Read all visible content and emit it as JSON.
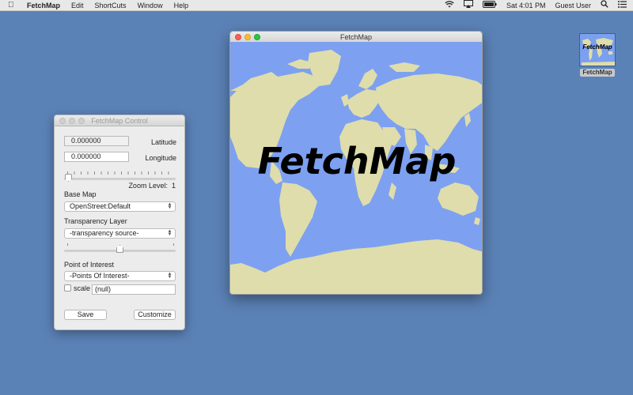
{
  "menubar": {
    "app_name": "FetchMap",
    "items": [
      "Edit",
      "ShortCuts",
      "Window",
      "Help"
    ],
    "clock": "Sat 4:01 PM",
    "user": "Guest User",
    "icons": [
      "apple-icon",
      "wifi-icon",
      "airplay-icon",
      "battery-icon",
      "search-icon",
      "list-icon"
    ]
  },
  "desktop_icon": {
    "thumb_text": "FetchMap",
    "label": "FetchMap"
  },
  "control": {
    "title": "FetchMap Control",
    "latitude": {
      "value": "0.000000",
      "label": "Latitude"
    },
    "longitude": {
      "value": "0.000000",
      "label": "Longitude"
    },
    "zoom": {
      "label": "Zoom Level:",
      "value": "1"
    },
    "base_map": {
      "label": "Base Map",
      "selected": "OpenStreet:Default"
    },
    "transparency": {
      "label": "Transparency Layer",
      "selected": "-transparency source-",
      "opacity_fraction": 0.5
    },
    "poi": {
      "label": "Point of Interest",
      "selected": "-Points Of Interest-"
    },
    "scale": {
      "label": "scale",
      "value": "(null)",
      "checked": false
    },
    "save_label": "Save",
    "customize_label": "Customize"
  },
  "map_window": {
    "title": "FetchMap",
    "overlay_text": "FetchMap",
    "ocean_color": "#7da1f0",
    "land_color": "#dfddab"
  }
}
